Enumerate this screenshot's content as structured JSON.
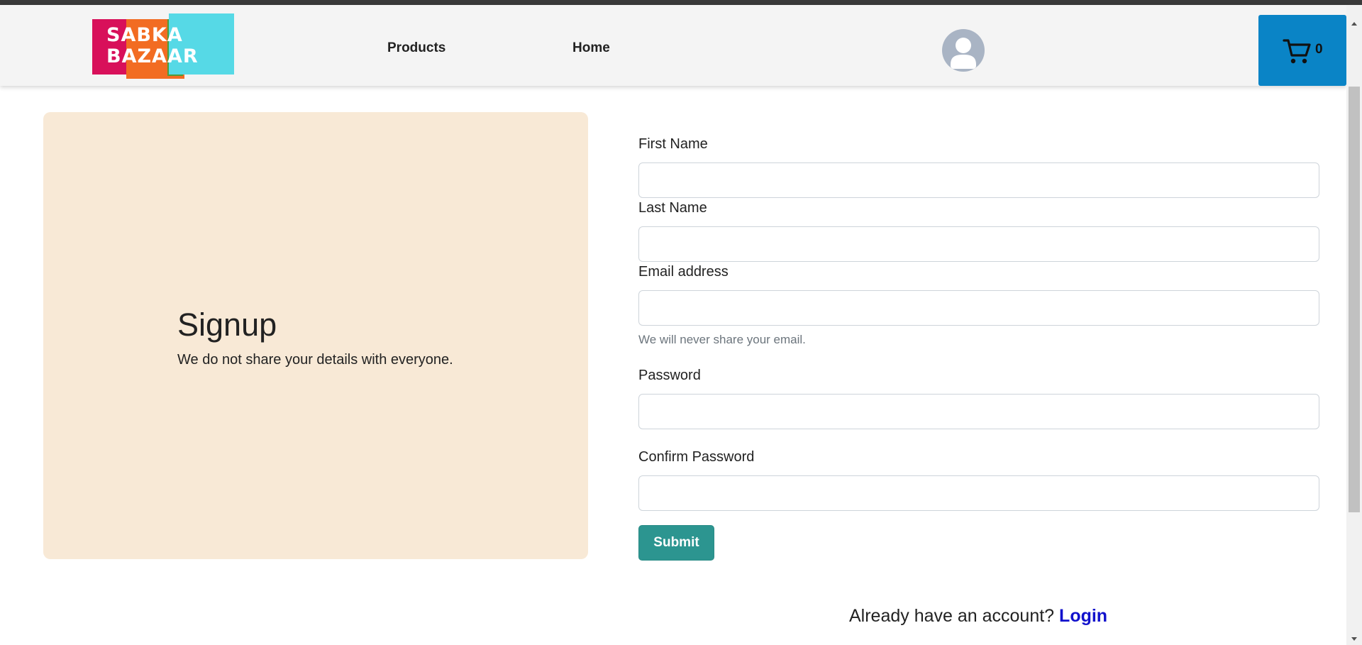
{
  "header": {
    "logo_text_line1": "SABKA",
    "logo_text_line2": "BAZAAR",
    "nav": {
      "products_label": "Products",
      "home_label": "Home"
    },
    "cart": {
      "icon": "cart-icon",
      "count": "0"
    },
    "avatar_icon": "user-avatar-icon"
  },
  "panel": {
    "title": "Signup",
    "subtitle": "We do not share your details with everyone."
  },
  "form": {
    "first_name_label": "First Name",
    "first_name_value": "",
    "last_name_label": "Last Name",
    "last_name_value": "",
    "email_label": "Email address",
    "email_value": "",
    "email_helper": "We will never share your email.",
    "password_label": "Password",
    "password_value": "",
    "confirm_password_label": "Confirm Password",
    "confirm_password_value": "",
    "submit_label": "Submit"
  },
  "footer": {
    "account_prompt": "Already have an account?",
    "login_label": "Login"
  },
  "colors": {
    "panel_bg": "#f8e9d6",
    "cart_bg": "#0a84c6",
    "submit_bg": "#2c9590",
    "link": "#1111cc"
  }
}
